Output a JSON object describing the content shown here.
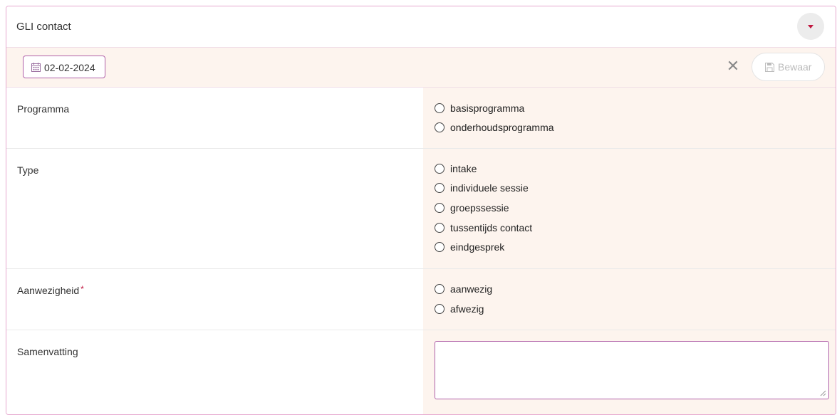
{
  "panel": {
    "title": "GLI contact",
    "collapse_icon": "caret-down-icon",
    "accent_color": "#c0163f",
    "border_color": "#e6a8cf"
  },
  "toolbar": {
    "date_value": "02-02-2024",
    "date_icon": "calendar-icon",
    "close_icon": "close-icon",
    "close_glyph": "✕",
    "save_label": "Bewaar",
    "save_icon": "floppy-disk-icon",
    "save_enabled": false
  },
  "form": {
    "programma": {
      "label": "Programma",
      "options": [
        "basisprogramma",
        "onderhoudsprogramma"
      ],
      "selected": null
    },
    "type": {
      "label": "Type",
      "options": [
        "intake",
        "individuele sessie",
        "groepssessie",
        "tussentijds contact",
        "eindgesprek"
      ],
      "selected": null
    },
    "aanwezigheid": {
      "label": "Aanwezigheid",
      "required_mark": "*",
      "options": [
        "aanwezig",
        "afwezig"
      ],
      "selected": null
    },
    "samenvatting": {
      "label": "Samenvatting",
      "value": ""
    }
  }
}
